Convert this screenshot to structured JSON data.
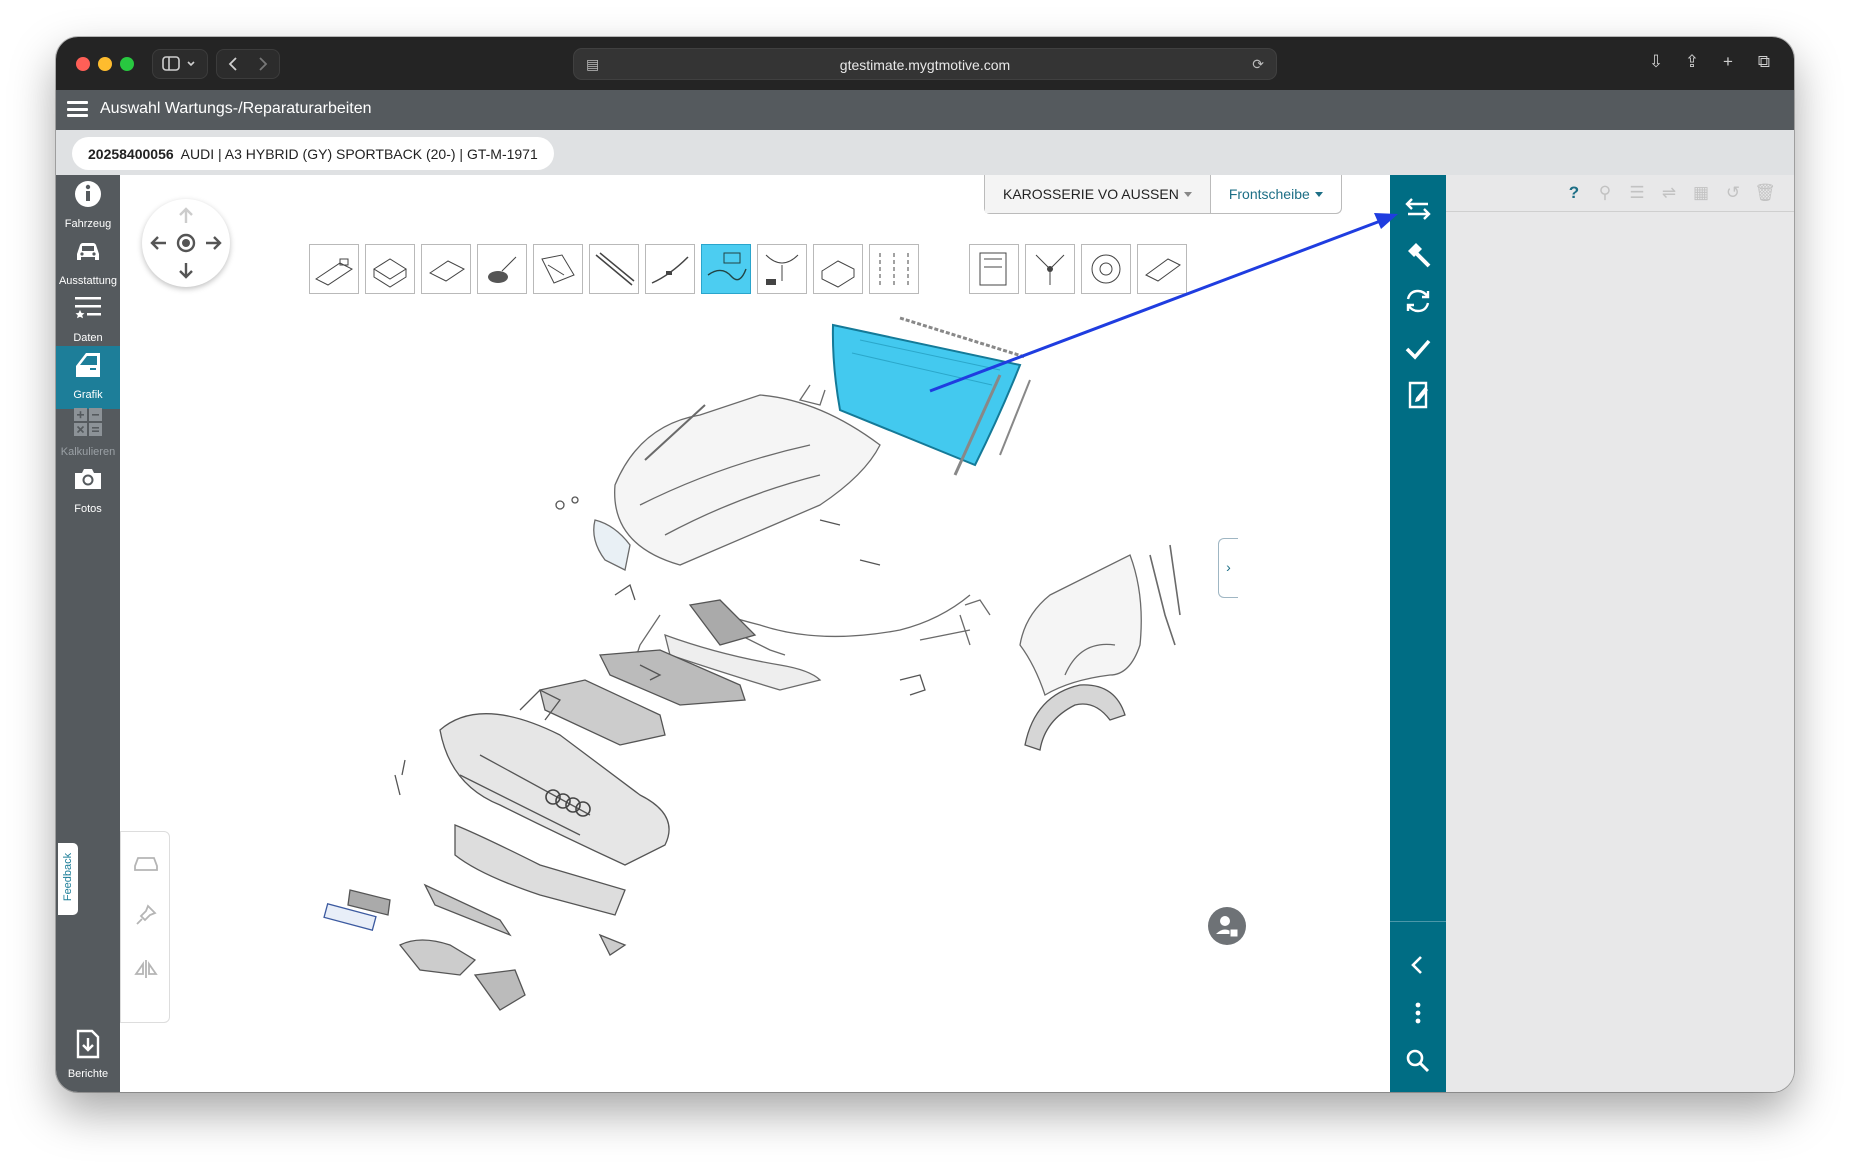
{
  "browser": {
    "url": "gtestimate.mygtmotive.com"
  },
  "app": {
    "title": "Auswahl Wartungs-/Reparaturarbeiten"
  },
  "vehicle": {
    "id": "20258400056",
    "description": "AUDI | A3 HYBRID (GY) SPORTBACK (20-) | GT-M-1971"
  },
  "nav": {
    "items": [
      {
        "label": "Fahrzeug",
        "icon": "info-icon"
      },
      {
        "label": "Ausstattung",
        "icon": "car-icon"
      },
      {
        "label": "Daten",
        "icon": "list-star-icon"
      },
      {
        "label": "Grafik",
        "icon": "car-door-icon",
        "active": true
      },
      {
        "label": "Kalkulieren",
        "icon": "calculator-icon",
        "disabled": true
      },
      {
        "label": "Fotos",
        "icon": "camera-icon"
      },
      {
        "label": "Berichte",
        "icon": "report-download-icon"
      }
    ]
  },
  "feedback": {
    "label": "Feedback"
  },
  "graphic": {
    "group_select": "KAROSSERIE VO AUSSEN",
    "part_select": "Frontscheibe"
  },
  "colors": {
    "teal": "#006d84",
    "highlight_part": "#43c9ef",
    "annotation_arrow": "#1f3de0",
    "nav_bg": "#555a5e"
  },
  "right_toolbar": {
    "icons": [
      "swap-arrows-icon",
      "hammer-icon",
      "refresh-icon",
      "check-icon",
      "edit-note-icon",
      "chevron-left-icon",
      "more-vertical-icon",
      "search-icon"
    ]
  },
  "panel": {
    "help_label": "?"
  }
}
